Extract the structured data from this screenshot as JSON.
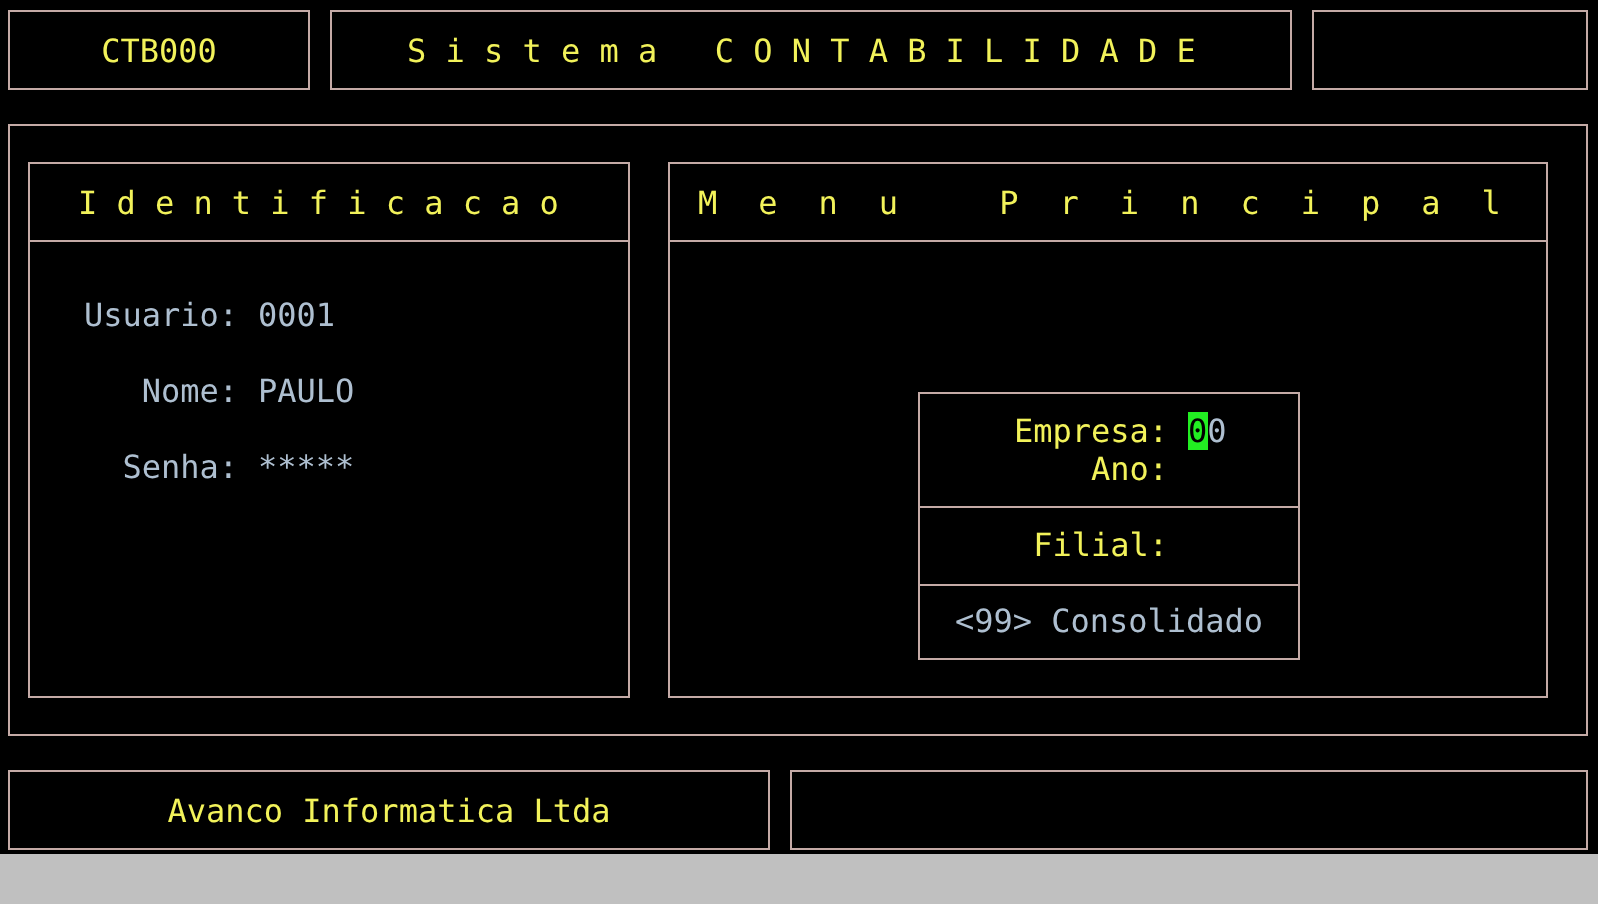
{
  "header": {
    "code": "CTB000",
    "title": "Sistema CONTABILIDADE"
  },
  "identification": {
    "title": "Identificacao",
    "fields": [
      {
        "label": "Usuario:",
        "value": "0001"
      },
      {
        "label": "Nome:",
        "value": "PAULO"
      },
      {
        "label": "Senha:",
        "value": "*****"
      }
    ]
  },
  "main_menu": {
    "title": "Menu Principal",
    "empresa": {
      "label": "Empresa:",
      "value": "00",
      "cursor": true
    },
    "ano": {
      "label": "Ano:"
    },
    "filial": {
      "label": "Filial:"
    },
    "option": "<99> Consolidado"
  },
  "footer": {
    "company": "Avanco Informatica Ltda"
  }
}
